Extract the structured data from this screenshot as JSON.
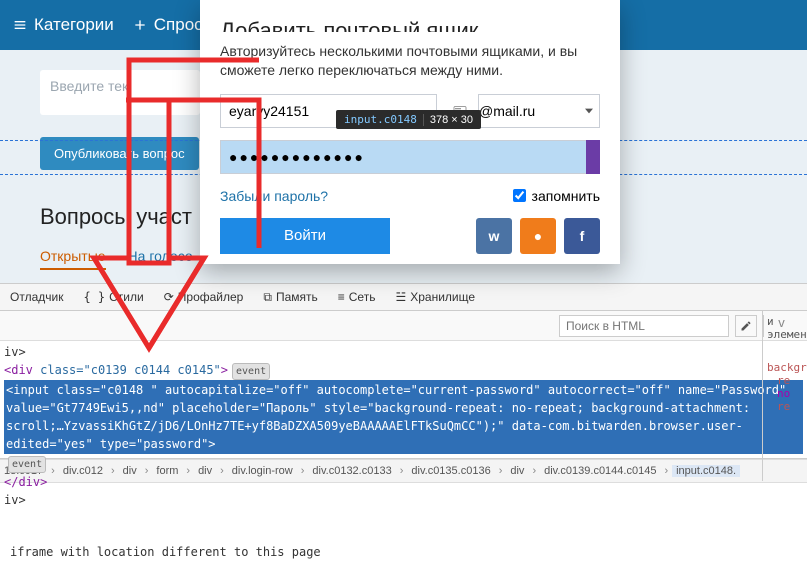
{
  "topbar": {
    "categories": "Категории",
    "ask": "Спрос"
  },
  "page": {
    "ask_placeholder": "Введите тек",
    "publish": "Опубликовать вопрос",
    "section_title": "Вопросы участ",
    "tab_open": "Открытые",
    "tab_voting": "На голосо"
  },
  "modal": {
    "title": "Добавить почтовый ящик",
    "desc": "Авторизуйтесь несколькими почтовыми ящиками, и вы сможете легко переключаться между ними.",
    "username": "eyarvy24151",
    "domain": "@mail.ru",
    "password_mask": "●●●●●●●●●●●●●",
    "forgot": "Забыли пароль?",
    "remember": "запомнить",
    "login": "Войти",
    "social": {
      "vk": "w",
      "ok": "●",
      "fb": "f"
    }
  },
  "tooltip": {
    "selector": "input.c0148",
    "dims": "378 × 30"
  },
  "devtools": {
    "tabs": {
      "debugger": "Отладчик",
      "styles": "Стили",
      "profiler": "Профайлер",
      "memory": "Память",
      "network": "Сеть",
      "storage": "Хранилище"
    },
    "search_placeholder": "Поиск в HTML",
    "code": {
      "l1": "iv>",
      "l2a": "<div",
      "l2b": "class=",
      "l2c": "\"c0139 c0144 c0145\"",
      "l2d": ">",
      "sel": "<input class=\"c0148 \" autocapitalize=\"off\" autocomplete=\"current-password\" autocorrect=\"off\" name=\"Password\" value=\"Gt7749Ewi5,,nd\" placeholder=\"Пароль\" style=\"background-repeat: no-repeat; background-attachment: scroll;…YzvassiKhGtZ/jD6/LOnHz7TE+yf8BaDZXA509yeBAAAAAElFTkSuQmCC\");\" data-com.bitwarden.browser.user-edited=\"yes\" type=\"password\">",
      "l4": "</div>",
      "l5": "iv>",
      "event": "event"
    },
    "breadcrumb": [
      "13.c017",
      "div.c012",
      "div",
      "form",
      "div",
      "div.login-row",
      "div.c0132.c0133",
      "div.c0135.c0136",
      "div",
      "div.c0139.c0144.c0145",
      "input.c0148."
    ],
    "sidebar": {
      "l1": "и",
      "l2": "элемент",
      "l3": "backgr",
      "l4": "re",
      "l5": "no",
      "l6": "re"
    }
  },
  "footer": "iframe with location different to this page"
}
